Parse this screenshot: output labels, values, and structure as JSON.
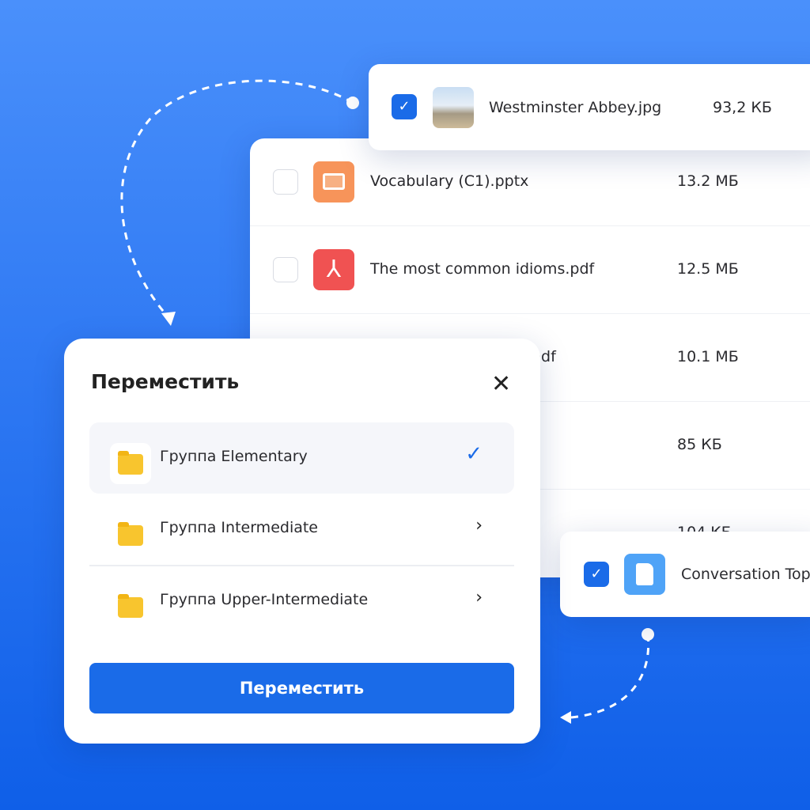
{
  "top_card": {
    "name": "Westminster Abbey.jpg",
    "size": "93,2 КБ",
    "checked": true
  },
  "files": [
    {
      "name": "Vocabulary (C1).pptx",
      "size": "13.2 МБ",
      "icon": "presentation-icon",
      "color": "#f7945a"
    },
    {
      "name": "The most common idioms.pdf",
      "size": "12.5 МБ",
      "icon": "pdf-icon",
      "color": "#f05252"
    },
    {
      "name": "pdf",
      "size": "10.1 МБ"
    },
    {
      "name": "",
      "size": "85 КБ"
    },
    {
      "name": "",
      "size": "104 КБ"
    }
  ],
  "bottom_card": {
    "name": "Conversation Top",
    "checked": true,
    "icon": "document-icon",
    "color": "#4fa3f7"
  },
  "modal": {
    "title": "Переместить",
    "items": [
      {
        "label": "Группа Elementary",
        "selected": true
      },
      {
        "label": "Группа Intermediate"
      },
      {
        "label": "Группа Upper-Intermediate"
      }
    ],
    "button": "Переместить"
  },
  "colors": {
    "accent": "#1a6be8",
    "folder": "#f8c52e"
  }
}
